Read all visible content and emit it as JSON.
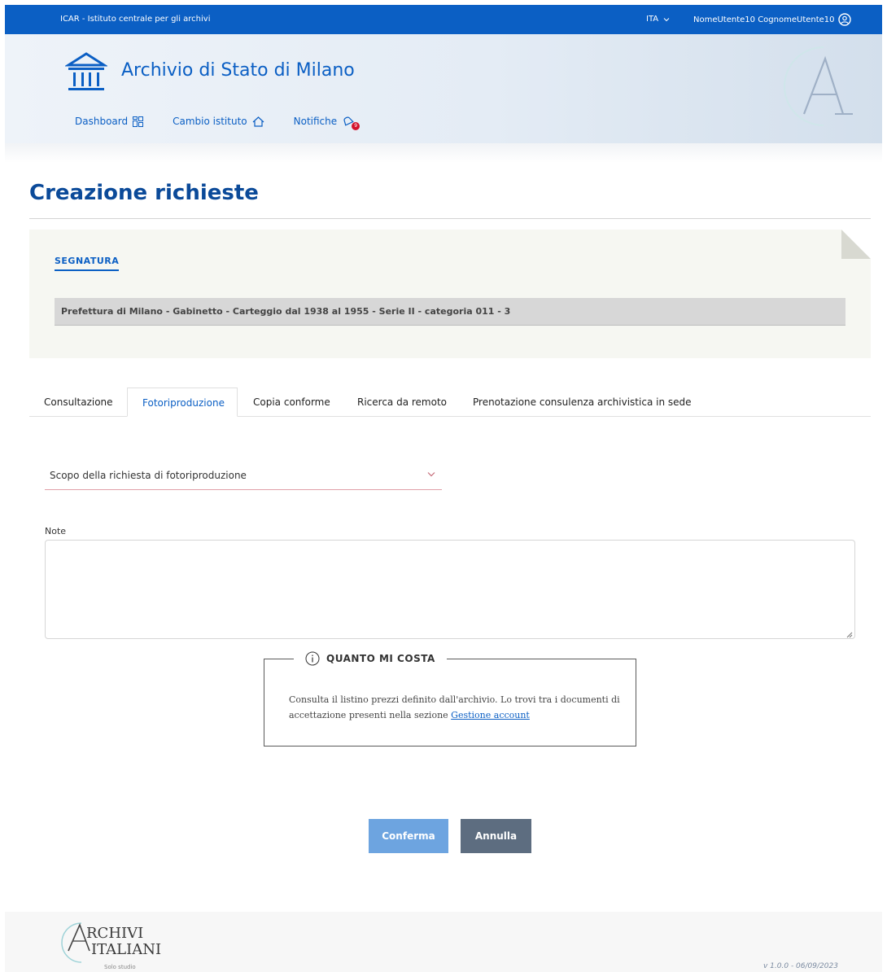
{
  "topbar": {
    "org": "ICAR - Istituto centrale per gli archivi",
    "lang": "ITA",
    "user": "NomeUtente10 CognomeUtente10"
  },
  "header": {
    "institute": "Archivio di Stato di Milano",
    "nav": {
      "dashboard": "Dashboard",
      "change": "Cambio istituto",
      "notifications": "Notifiche"
    },
    "notification_count": "9"
  },
  "page": {
    "title": "Creazione richieste"
  },
  "segnatura": {
    "label": "SEGNATURA",
    "value": "Prefettura di Milano - Gabinetto - Carteggio dal 1938 al 1955 - Serie II - categoria 011 - 3"
  },
  "tabs": [
    {
      "label": "Consultazione"
    },
    {
      "label": "Fotoriproduzione"
    },
    {
      "label": "Copia conforme"
    },
    {
      "label": "Ricerca da remoto"
    },
    {
      "label": "Prenotazione consulenza archivistica in sede"
    }
  ],
  "form": {
    "scope_label": "Scopo della richiesta di fotoriproduzione",
    "note_label": "Note",
    "note_value": ""
  },
  "cost": {
    "title": "QUANTO MI COSTA",
    "text": "Consulta il listino prezzi definito dall'archivio. Lo trovi tra i documenti di accettazione presenti nella sezione ",
    "link": "Gestione account"
  },
  "buttons": {
    "confirm": "Conferma",
    "cancel": "Annulla"
  },
  "footer": {
    "brand_line1": "RCHIVI",
    "brand_line2": "ITALIANI",
    "brand_sub": "Solo studio",
    "version": "v 1.0.0 - 06/09/2023"
  },
  "colors": {
    "primary": "#0b5fc4",
    "title": "#0b4a99",
    "badge": "#d3112b"
  }
}
